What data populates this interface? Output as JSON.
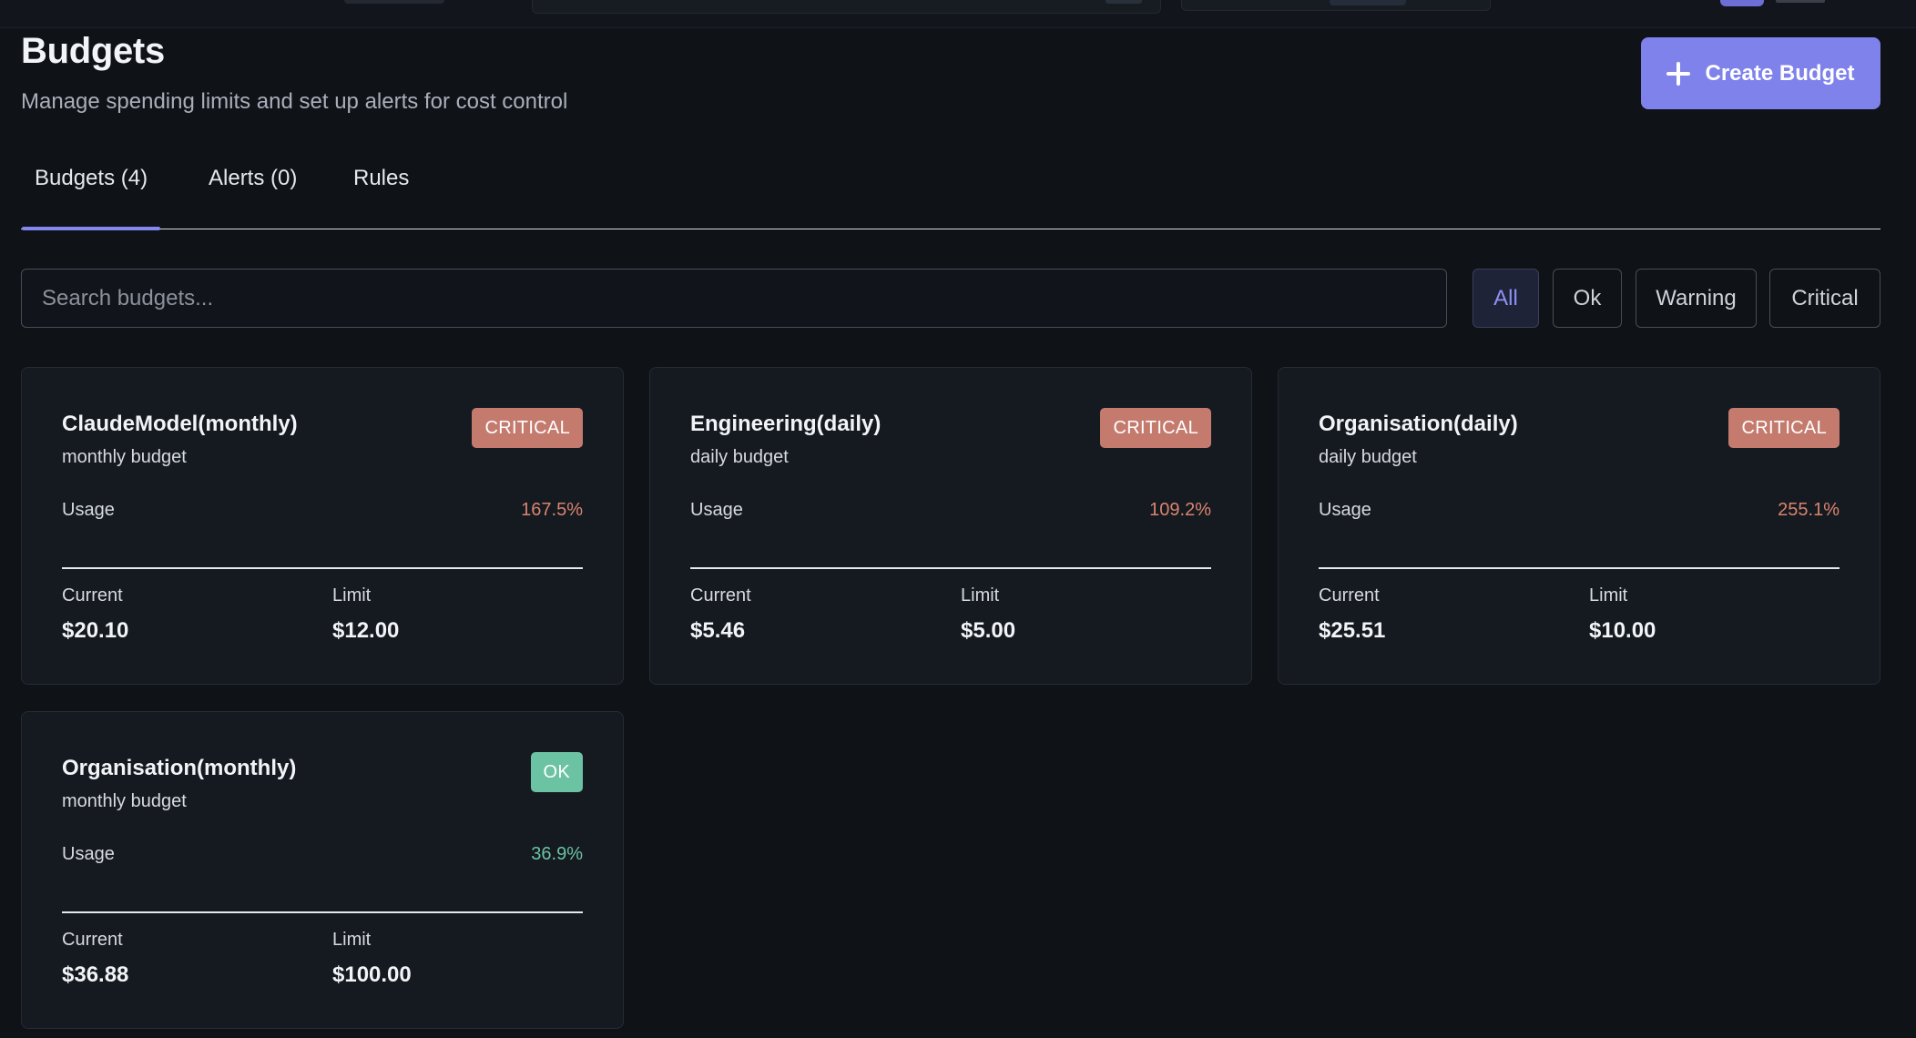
{
  "header": {
    "title": "Budgets",
    "subtitle": "Manage spending limits and set up alerts for cost control",
    "create_label": "Create Budget"
  },
  "tabs": [
    {
      "label": "Budgets (4)",
      "active": true
    },
    {
      "label": "Alerts (0)",
      "active": false
    },
    {
      "label": "Rules",
      "active": false
    }
  ],
  "search": {
    "placeholder": "Search budgets..."
  },
  "filters": [
    {
      "label": "All",
      "active": true
    },
    {
      "label": "Ok",
      "active": false
    },
    {
      "label": "Warning",
      "active": false
    },
    {
      "label": "Critical",
      "active": false
    }
  ],
  "labels": {
    "usage": "Usage",
    "current": "Current",
    "limit": "Limit"
  },
  "budgets": [
    {
      "name": "ClaudeModel(monthly)",
      "period": "monthly budget",
      "status": "CRITICAL",
      "usage": "167.5%",
      "current": "$20.10",
      "limit": "$12.00"
    },
    {
      "name": "Engineering(daily)",
      "period": "daily budget",
      "status": "CRITICAL",
      "usage": "109.2%",
      "current": "$5.46",
      "limit": "$5.00"
    },
    {
      "name": "Organisation(daily)",
      "period": "daily budget",
      "status": "CRITICAL",
      "usage": "255.1%",
      "current": "$25.51",
      "limit": "$10.00"
    },
    {
      "name": "Organisation(monthly)",
      "period": "monthly budget",
      "status": "OK",
      "usage": "36.9%",
      "current": "$36.88",
      "limit": "$100.00"
    }
  ],
  "colors": {
    "accent": "#7f82eb",
    "critical": "#c47b6e",
    "ok": "#6cc3a3",
    "background": "#0f1217",
    "card": "#151920"
  }
}
